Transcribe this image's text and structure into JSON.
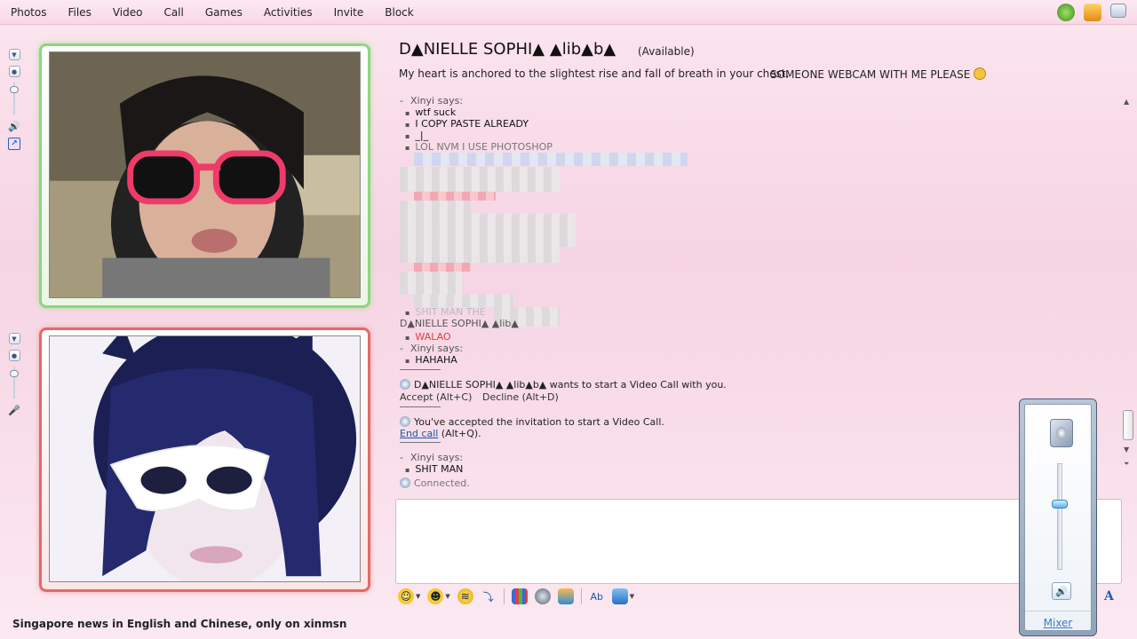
{
  "menu": [
    "Photos",
    "Files",
    "Video",
    "Call",
    "Games",
    "Activities",
    "Invite",
    "Block"
  ],
  "top_icons": [
    "xbox-icon",
    "shield-icon",
    "options-menu-icon"
  ],
  "contact": {
    "name": "D▲NIELLE SOPHI▲ ▲lib▲b▲",
    "status": "(Available)",
    "personal_message": "My heart is anchored to the slightest rise and fall of breath in your chest.",
    "personal_message_2": "SOMEONE WEBCAM WITH ME PLEASE"
  },
  "conversation": {
    "sender1": "Xinyi says:",
    "msgs1": [
      "wtf suck",
      "I COPY PASTE ALREADY",
      "_|_",
      "LOL NVM I USE PHOTOSHOP"
    ],
    "faded_msg": "SHIT MAN THE",
    "sender2": "D▲NIELLE SOPHI▲ ▲lib▲",
    "msg_walao": "WALAO",
    "sender3": "Xinyi says:",
    "msg_hahaha": "HAHAHA",
    "invite_text": "D▲NIELLE SOPHI▲ ▲lib▲b▲ wants to start a Video Call with you.",
    "accept": "Accept (Alt+C)",
    "decline": "Decline (Alt+D)",
    "accepted_text": "You've accepted the invitation to start a Video Call.",
    "end_call_link": "End call",
    "end_call_shortcut": "(Alt+Q).",
    "sender4": "Xinyi says:",
    "msg_shitman": "SHIT MAN",
    "connected": "Connected."
  },
  "mixer": {
    "link": "Mixer",
    "volume_level": 0.62
  },
  "footer": {
    "ad_text": "Singapore news in English and Chinese, only on xinmsn"
  },
  "toolbar": {
    "font_label": "A"
  },
  "colors": {
    "contact_frame": "#8ed67e",
    "self_frame": "#e26a6a",
    "alert_text": "#e23b3b"
  }
}
